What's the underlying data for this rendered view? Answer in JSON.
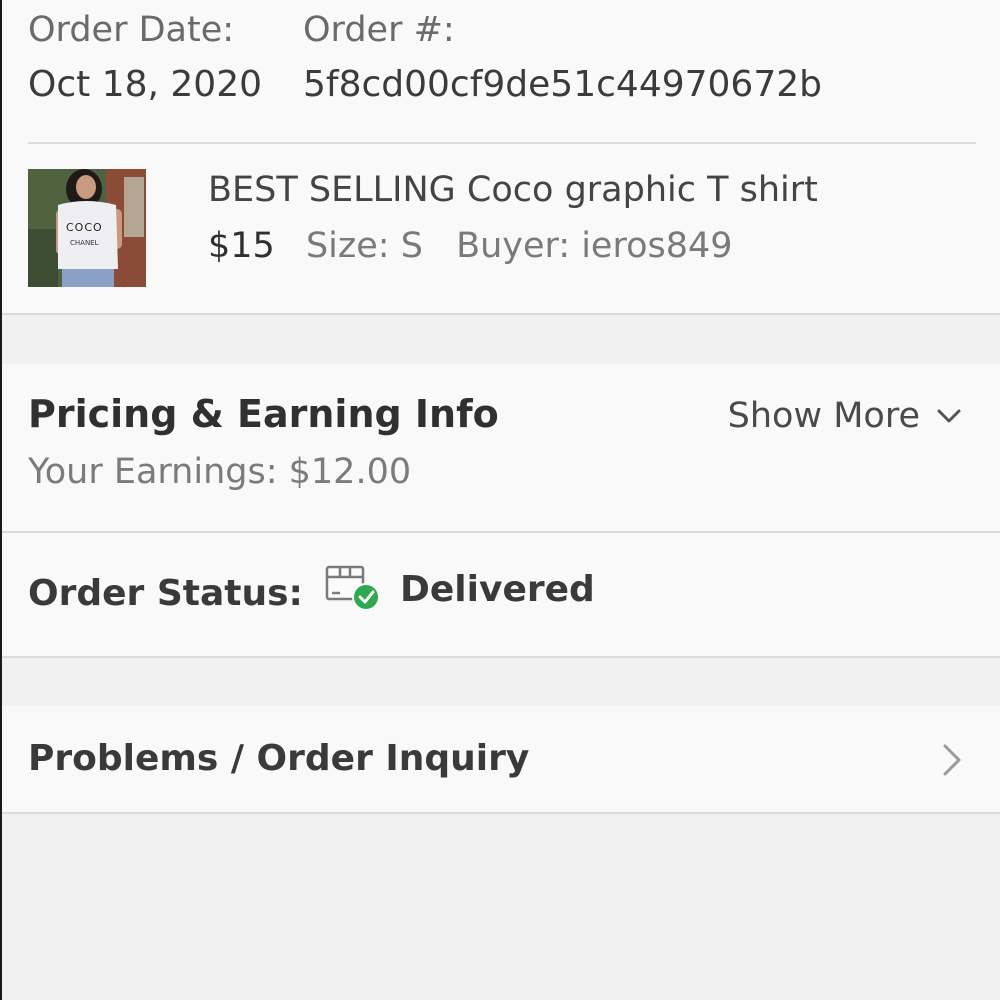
{
  "order": {
    "date_label": "Order Date:",
    "date_value": "Oct 18, 2020",
    "number_label": "Order #:",
    "number_value": "5f8cd00cf9de51c44970672b"
  },
  "item": {
    "title": "BEST SELLING Coco graphic T shirt",
    "price": "$15",
    "size": "Size: S",
    "buyer": "Buyer: ieros849",
    "thumbnail_text": [
      "COCO",
      "CHANEL"
    ]
  },
  "pricing": {
    "title": "Pricing & Earning Info",
    "earnings": "Your Earnings: $12.00",
    "show_more_label": "Show More",
    "show_more_icon": "chevron-down-icon"
  },
  "status": {
    "label": "Order Status:",
    "icon": "package-delivered-icon",
    "value": "Delivered",
    "status_color": "#2fa84f"
  },
  "problems": {
    "label": "Problems / Order Inquiry",
    "icon": "chevron-right-icon"
  }
}
